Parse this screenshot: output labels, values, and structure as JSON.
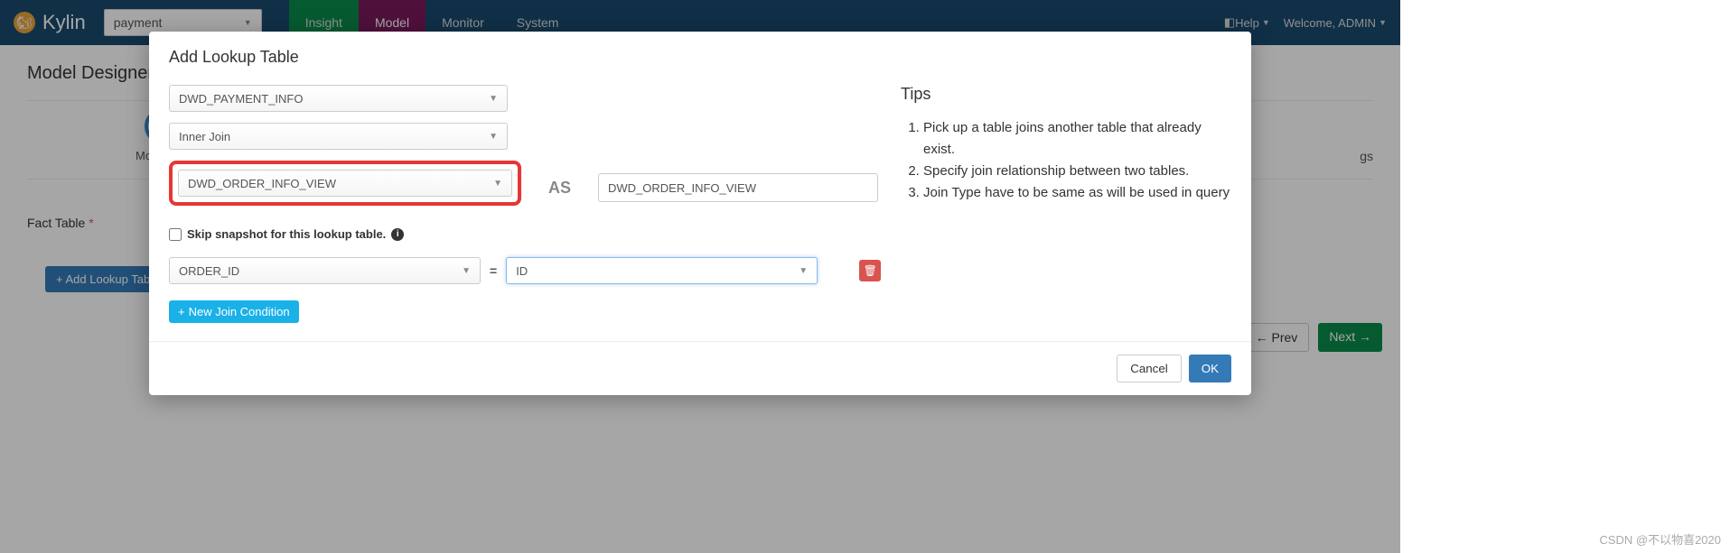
{
  "navbar": {
    "brand": "Kylin",
    "project_selected": "payment",
    "tabs": [
      "Insight",
      "Model",
      "Monitor",
      "System"
    ],
    "help_label": "Help",
    "welcome_label": "Welcome, ADMIN"
  },
  "page": {
    "title": "Model Designer",
    "step_label": "Mod",
    "right_hint": "gs",
    "fact_table_label": "Fact Table",
    "add_lookup_btn": "Add Lookup Tabl",
    "prev_label": "Prev",
    "next_label": "Next"
  },
  "modal": {
    "title": "Add Lookup Table",
    "fact_table_select": "DWD_PAYMENT_INFO",
    "join_type_select": "Inner Join",
    "lookup_table_select": "DWD_ORDER_INFO_VIEW",
    "as_label": "AS",
    "alias_value": "DWD_ORDER_INFO_VIEW",
    "skip_snapshot_label": "Skip snapshot for this lookup table.",
    "join_left": "ORDER_ID",
    "join_right": "ID",
    "new_join_label": "New Join Condition",
    "tips_title": "Tips",
    "tips": [
      "Pick up a table joins another table that already exist.",
      "Specify join relationship between two tables.",
      "Join Type have to be same as will be used in query"
    ],
    "cancel_label": "Cancel",
    "ok_label": "OK"
  },
  "watermark": "CSDN @不以物喜2020"
}
